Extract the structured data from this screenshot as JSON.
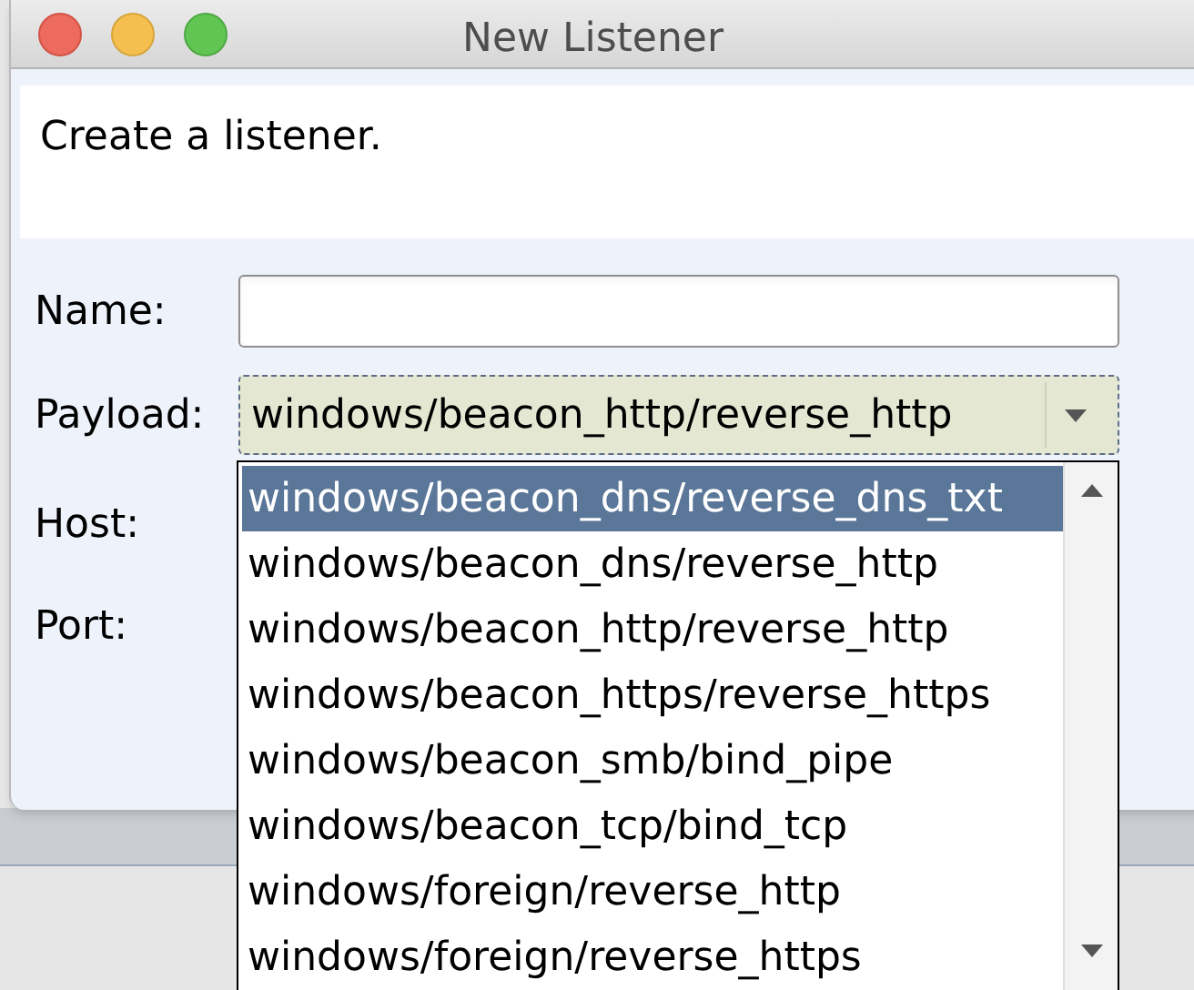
{
  "window": {
    "title": "New Listener"
  },
  "description": "Create a listener.",
  "form": {
    "name": {
      "label": "Name:"
    },
    "payload": {
      "label": "Payload:",
      "value": "windows/beacon_http/reverse_http",
      "expanded": true
    },
    "host": {
      "label": "Host:"
    },
    "port": {
      "label": "Port:"
    }
  },
  "payload_options": [
    {
      "label": "windows/beacon_dns/reverse_dns_txt",
      "selected": true
    },
    {
      "label": "windows/beacon_dns/reverse_http",
      "selected": false
    },
    {
      "label": "windows/beacon_http/reverse_http",
      "selected": false
    },
    {
      "label": "windows/beacon_https/reverse_https",
      "selected": false
    },
    {
      "label": "windows/beacon_smb/bind_pipe",
      "selected": false
    },
    {
      "label": "windows/beacon_tcp/bind_tcp",
      "selected": false
    },
    {
      "label": "windows/foreign/reverse_http",
      "selected": false
    },
    {
      "label": "windows/foreign/reverse_https",
      "selected": false
    }
  ]
}
